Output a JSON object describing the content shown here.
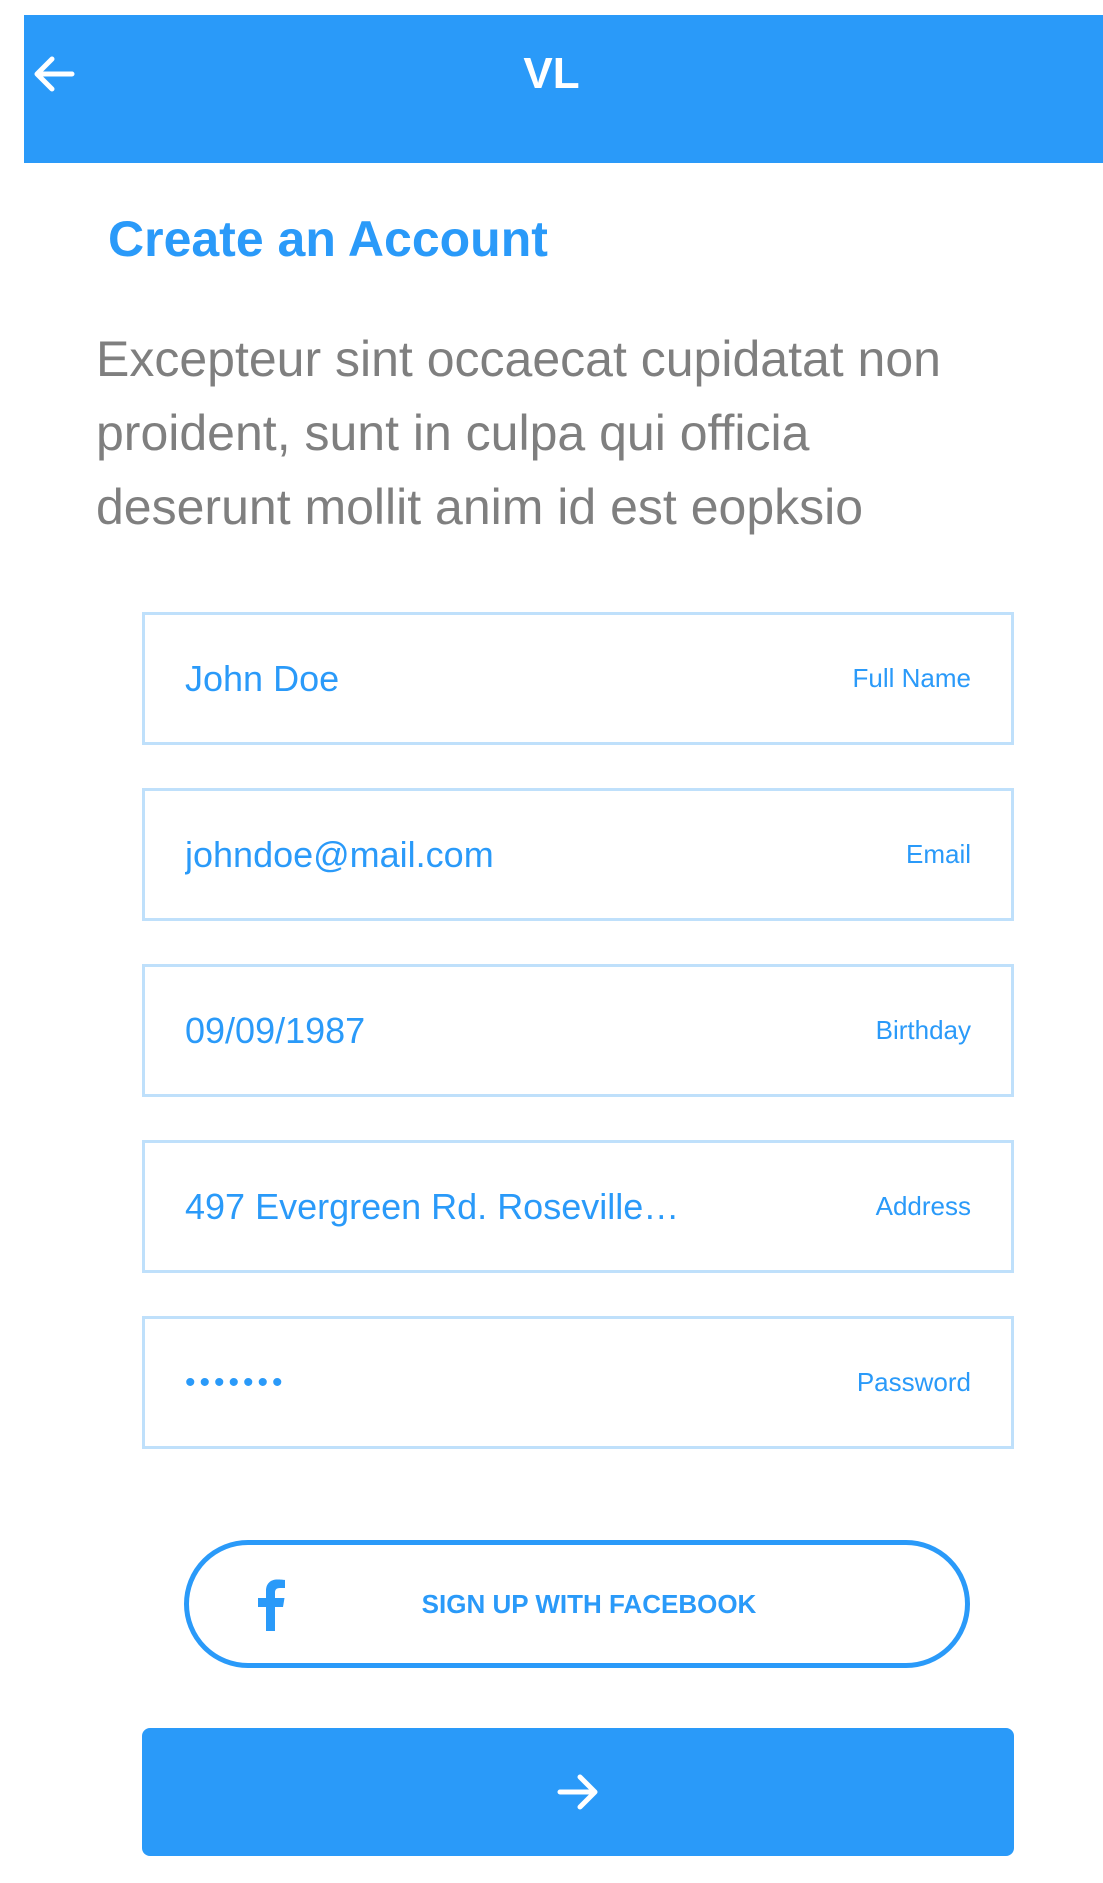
{
  "header": {
    "title": "VL",
    "back_icon": "arrow-left-icon",
    "background": "#2a9af9"
  },
  "page": {
    "title": "Create an Account",
    "intro_lines": [
      "Excepteur sint occaecat cupidatat non",
      "proident, sunt in culpa qui officia",
      "deserunt mollit anim id est eopksio"
    ]
  },
  "form": {
    "fields": [
      {
        "value": "John Doe",
        "label": "Full Name"
      },
      {
        "value": "johndoe@mail.com",
        "label": "Email"
      },
      {
        "value": "09/09/1987",
        "label": "Birthday"
      },
      {
        "value": "497 Evergreen Rd. Roseville…",
        "label": "Address"
      },
      {
        "value": "•••••••",
        "label": "Password"
      }
    ]
  },
  "facebook_button": {
    "label": "SIGN UP WITH FACEBOOK",
    "icon": "facebook-icon"
  },
  "submit_button": {
    "icon": "arrow-right-icon"
  },
  "colors": {
    "accent": "#2a9af9",
    "field_border": "#bfe0fb",
    "body_text": "#7f7f7f"
  }
}
